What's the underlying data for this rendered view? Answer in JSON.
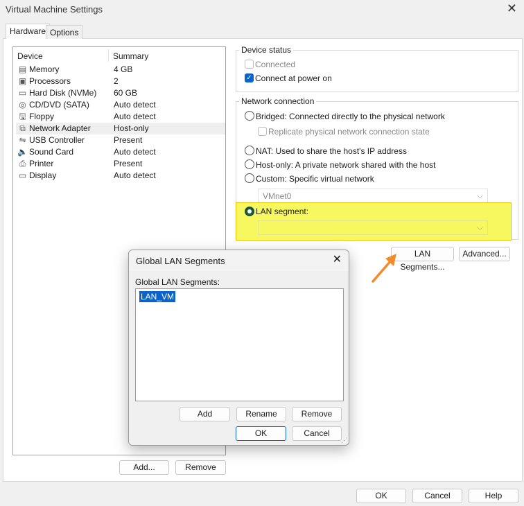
{
  "window": {
    "title": "Virtual Machine Settings",
    "close": "✕"
  },
  "tabs": [
    "Hardware",
    "Options"
  ],
  "devices": {
    "col_device": "Device",
    "col_summary": "Summary",
    "rows": [
      {
        "icon": "memory-icon",
        "glyph": "▤",
        "name": "Memory",
        "summary": "4 GB"
      },
      {
        "icon": "processor-icon",
        "glyph": "▣",
        "name": "Processors",
        "summary": "2"
      },
      {
        "icon": "hard-disk-icon",
        "glyph": "▭",
        "name": "Hard Disk (NVMe)",
        "summary": "60 GB"
      },
      {
        "icon": "cd-icon",
        "glyph": "◎",
        "name": "CD/DVD (SATA)",
        "summary": "Auto detect"
      },
      {
        "icon": "floppy-icon",
        "glyph": "🖫",
        "name": "Floppy",
        "summary": "Auto detect"
      },
      {
        "icon": "network-icon",
        "glyph": "⧉",
        "name": "Network Adapter",
        "summary": "Host-only"
      },
      {
        "icon": "usb-icon",
        "glyph": "⇋",
        "name": "USB Controller",
        "summary": "Present"
      },
      {
        "icon": "sound-icon",
        "glyph": "🔈",
        "name": "Sound Card",
        "summary": "Auto detect"
      },
      {
        "icon": "printer-icon",
        "glyph": "⎙",
        "name": "Printer",
        "summary": "Present"
      },
      {
        "icon": "display-icon",
        "glyph": "▭",
        "name": "Display",
        "summary": "Auto detect"
      }
    ],
    "selected": "Network Adapter",
    "add": "Add...",
    "remove": "Remove"
  },
  "device_status": {
    "label": "Device status",
    "connected": "Connected",
    "connected_checked": false,
    "power_on": "Connect at power on",
    "power_on_checked": true
  },
  "network": {
    "label": "Network connection",
    "bridged": "Bridged: Connected directly to the physical network",
    "replicate": "Replicate physical network connection state",
    "nat": "NAT: Used to share the host's IP address",
    "hostonly": "Host-only: A private network shared with the host",
    "custom": "Custom: Specific virtual network",
    "custom_value": "VMnet0",
    "lan": "LAN segment:",
    "lan_value": "",
    "selected": "lan",
    "highlight_color": "#f7f760"
  },
  "buttons": {
    "lan_segments": "LAN Segments...",
    "advanced": "Advanced...",
    "ok": "OK",
    "cancel": "Cancel",
    "help": "Help"
  },
  "dialog": {
    "title": "Global LAN Segments",
    "close": "✕",
    "list_label": "Global LAN Segments:",
    "items": [
      "LAN_VM"
    ],
    "selected": "LAN_VM",
    "add": "Add",
    "rename": "Rename",
    "remove": "Remove",
    "ok": "OK",
    "cancel": "Cancel"
  },
  "annotation": {
    "arrow_color": "#f28a2e"
  }
}
